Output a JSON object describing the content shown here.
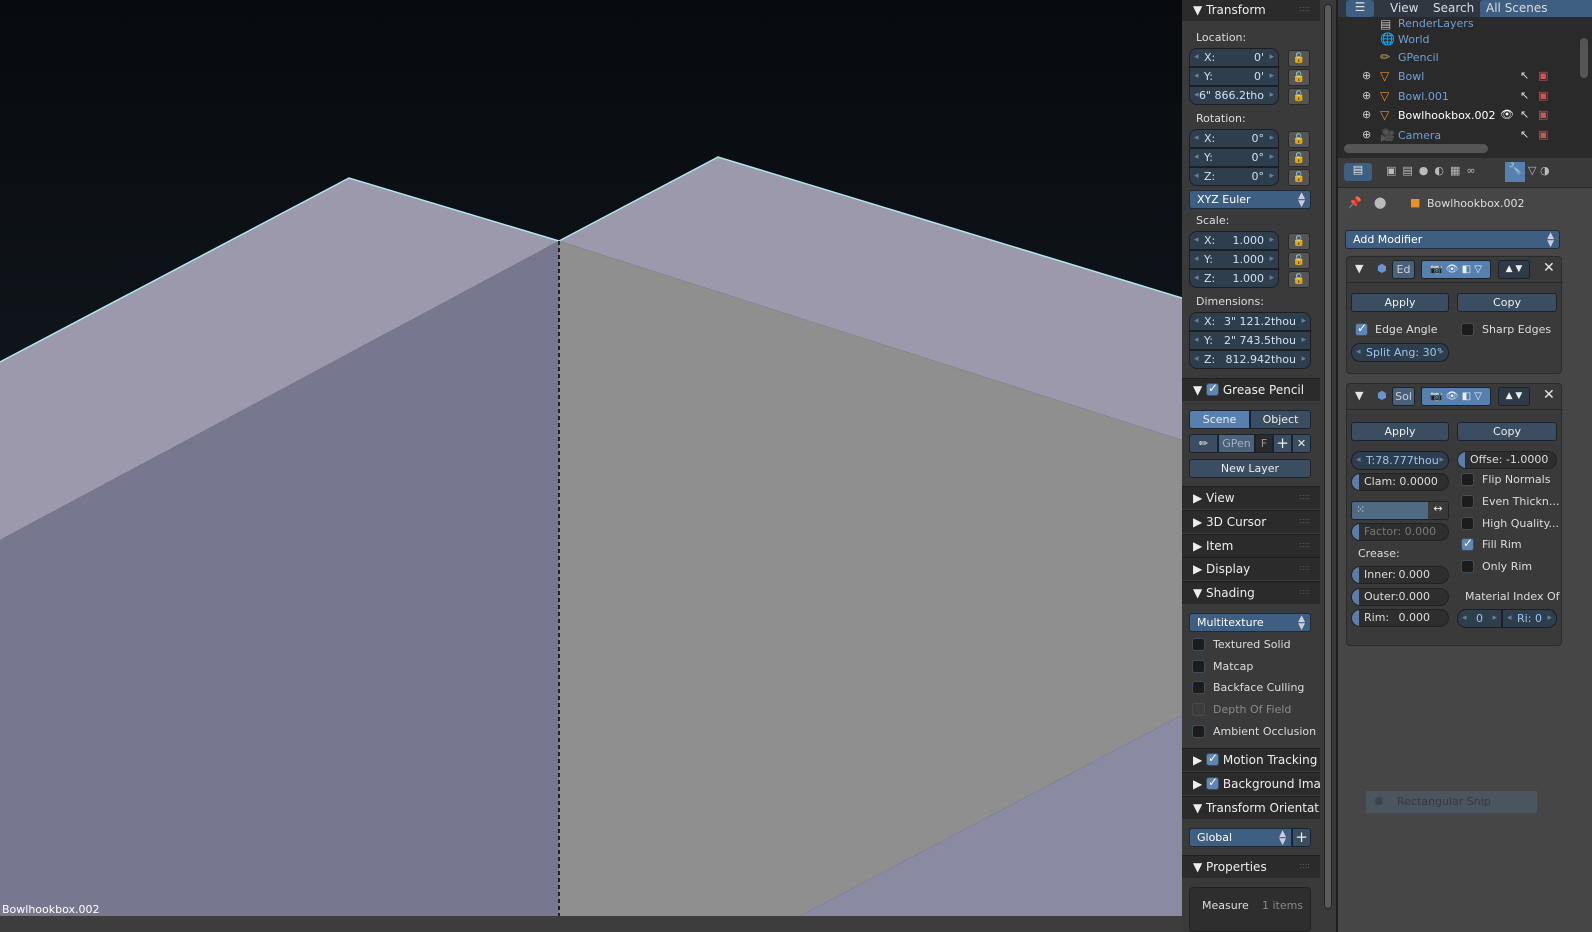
{
  "viewport": {
    "active_object_label": "Bowlhookbox.002",
    "colors": {
      "background_top": "#070a0e",
      "background_bottom": "#1d2630",
      "face_light": "#9b99ab",
      "face_dark": "#777890",
      "face_grey": "#8f8f8f",
      "face_lower_right": "#8a8aa2",
      "edge_highlight": "#aee8ee"
    }
  },
  "npanel": {
    "transform": {
      "title": "Transform",
      "location_label": "Location:",
      "location": [
        {
          "axis": "X:",
          "value": "0'"
        },
        {
          "axis": "Y:",
          "value": "0'"
        },
        {
          "axis": "",
          "value": "6\" 866.2tho"
        }
      ],
      "rotation_label": "Rotation:",
      "rotation": [
        {
          "axis": "X:",
          "value": "0°"
        },
        {
          "axis": "Y:",
          "value": "0°"
        },
        {
          "axis": "Z:",
          "value": "0°"
        }
      ],
      "rotation_mode": "XYZ Euler",
      "scale_label": "Scale:",
      "scale": [
        {
          "axis": "X:",
          "value": "1.000"
        },
        {
          "axis": "Y:",
          "value": "1.000"
        },
        {
          "axis": "Z:",
          "value": "1.000"
        }
      ],
      "dimensions_label": "Dimensions:",
      "dimensions": [
        {
          "axis": "X:",
          "value": "3\" 121.2thou"
        },
        {
          "axis": "Y:",
          "value": "2\" 743.5thou"
        },
        {
          "axis": "Z:",
          "value": "812.942thou"
        }
      ]
    },
    "grease_pencil": {
      "title": "Grease Pencil",
      "tabs": [
        "Scene",
        "Object"
      ],
      "layer_name": "GPen",
      "f_label": "F",
      "new_layer": "New Layer"
    },
    "collapsed_panels": [
      "View",
      "3D Cursor",
      "Item",
      "Display"
    ],
    "shading": {
      "title": "Shading",
      "mode": "Multitexture",
      "options": [
        {
          "label": "Textured Solid",
          "checked": false,
          "enabled": true
        },
        {
          "label": "Matcap",
          "checked": false,
          "enabled": true
        },
        {
          "label": "Backface Culling",
          "checked": false,
          "enabled": true
        },
        {
          "label": "Depth Of Field",
          "checked": false,
          "enabled": false
        },
        {
          "label": "Ambient Occlusion",
          "checked": false,
          "enabled": true
        }
      ]
    },
    "motion_tracking": "Motion Tracking",
    "background_images": "Background Ima",
    "transform_orientations": {
      "title": "Transform Orientatio",
      "value": "Global"
    },
    "properties": {
      "title": "Properties",
      "measure_label": "Measure",
      "measure_count": "1 items"
    }
  },
  "outliner": {
    "menu": [
      "View",
      "Search"
    ],
    "scope": "All Scenes",
    "rows": [
      {
        "name": "RenderLayers",
        "icon": "render-layers-icon"
      },
      {
        "name": "World",
        "icon": "world-icon"
      },
      {
        "name": "GPencil",
        "icon": "pencil-icon"
      },
      {
        "name": "Bowl",
        "icon": "mesh-icon"
      },
      {
        "name": "Bowl.001",
        "icon": "mesh-icon"
      },
      {
        "name": "Bowlhookbox.002",
        "icon": "mesh-icon",
        "active": true
      },
      {
        "name": "Camera",
        "icon": "camera-icon"
      }
    ]
  },
  "properties_editor": {
    "breadcrumb_object": "Bowlhookbox.002",
    "add_modifier": "Add Modifier",
    "edge_split": {
      "name": "Ed",
      "apply": "Apply",
      "copy": "Copy",
      "edge_angle": {
        "label": "Edge Angle",
        "checked": true
      },
      "sharp_edges": {
        "label": "Sharp Edges",
        "checked": false
      },
      "split_angle": "Split Ang: 30°"
    },
    "solidify": {
      "name": "Sol",
      "apply": "Apply",
      "copy": "Copy",
      "thickness": "T:78.777thou",
      "offset": "Offse: -1.0000",
      "clamp": "Clam: 0.0000",
      "factor": "Factor: 0.000",
      "crease_label": "Crease:",
      "inner": {
        "label": "Inner:",
        "value": "0.000"
      },
      "outer": {
        "label": "Outer:",
        "value": "0.000"
      },
      "rim": {
        "label": "Rim:",
        "value": "0.000"
      },
      "flip_normals": {
        "label": "Flip Normals",
        "checked": false
      },
      "even_thickness": {
        "label": "Even Thickn...",
        "checked": false
      },
      "high_quality": {
        "label": "High Quality...",
        "checked": false
      },
      "fill_rim": {
        "label": "Fill Rim",
        "checked": true
      },
      "only_rim": {
        "label": "Only Rim",
        "checked": false
      },
      "material_index_label": "Material Index Of",
      "material_index": "0",
      "material_rim_label": "Ri:",
      "material_rim": "0"
    },
    "overlay_snip": "Rectangular Snip"
  }
}
